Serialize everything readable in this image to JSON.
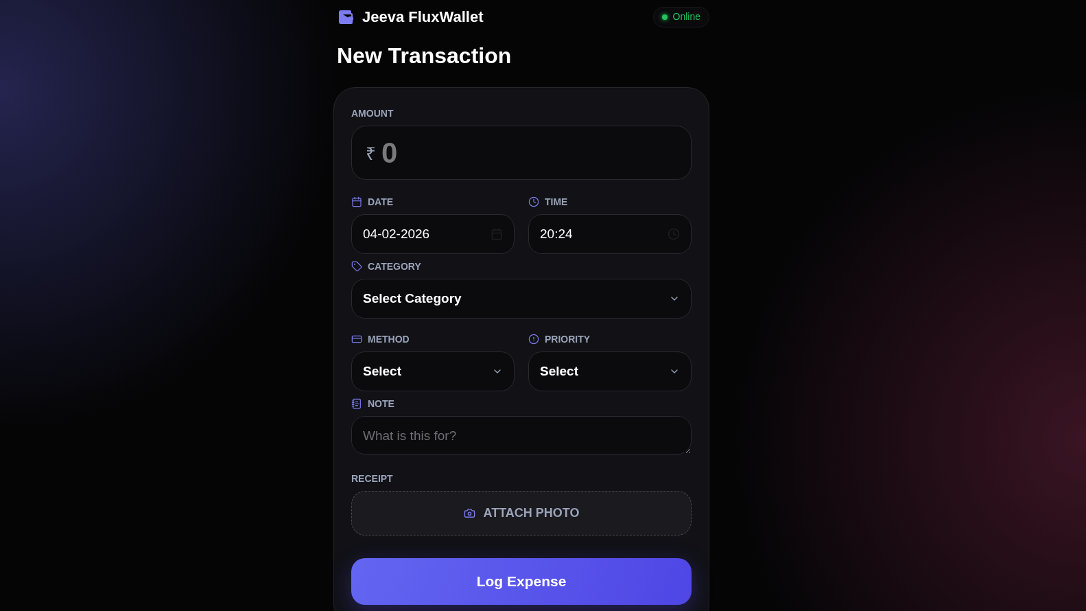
{
  "header": {
    "app_name": "Jeeva FluxWallet",
    "status": {
      "label": "Online",
      "online": true
    }
  },
  "title": "New Transaction",
  "amount": {
    "label": "AMOUNT",
    "currency_symbol": "₹",
    "placeholder": "0"
  },
  "rows": [
    [
      {
        "kind": "date",
        "label": "DATE",
        "value": "04-02-2026"
      },
      {
        "kind": "time",
        "label": "TIME",
        "value": "20:24"
      }
    ],
    [
      {
        "kind": "select",
        "label": "CATEGORY",
        "value": "Select Category"
      }
    ],
    [
      {
        "kind": "select",
        "label": "METHOD",
        "value": "Select"
      },
      {
        "kind": "select",
        "label": "PRIORITY",
        "value": "Select"
      }
    ],
    [
      {
        "kind": "textarea",
        "label": "NOTE",
        "placeholder": "What is this for?"
      }
    ]
  ],
  "receipt": {
    "label": "RECEIPT",
    "button": "ATTACH PHOTO"
  },
  "submit": "Log Expense"
}
